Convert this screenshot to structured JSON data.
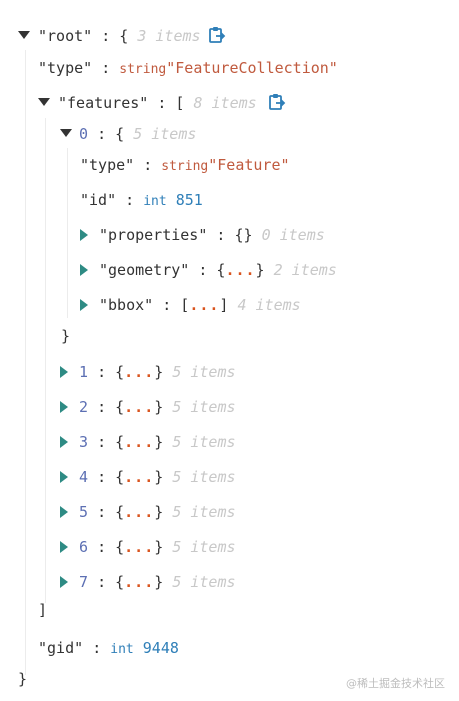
{
  "root": {
    "key": "\"root\"",
    "colon": ":",
    "open": "{",
    "close": "}",
    "count": "3 items"
  },
  "type_row": {
    "key": "\"type\"",
    "colon": ":",
    "type_tag": "string",
    "value": "\"FeatureCollection\""
  },
  "features": {
    "key": "\"features\"",
    "colon": ":",
    "open": "[",
    "close": "]",
    "count": "8 items"
  },
  "feature0": {
    "index": "0",
    "colon": ":",
    "open": "{",
    "close": "}",
    "count": "5 items",
    "type_key": "\"type\"",
    "type_tag": "string",
    "type_value": "\"Feature\"",
    "id_key": "\"id\"",
    "id_tag": "int",
    "id_value": "851",
    "properties_key": "\"properties\"",
    "properties_value": "{}",
    "properties_count": "0 items",
    "geometry_key": "\"geometry\"",
    "geometry_open": "{",
    "geometry_ellipsis": "...",
    "geometry_close": "}",
    "geometry_count": "2 items",
    "bbox_key": "\"bbox\"",
    "bbox_open": "[",
    "bbox_ellipsis": "...",
    "bbox_close": "]",
    "bbox_count": "4 items"
  },
  "collapsed_features": [
    {
      "index": "1",
      "colon": ":",
      "open": "{",
      "ellipsis": "...",
      "close": "}",
      "count": "5 items"
    },
    {
      "index": "2",
      "colon": ":",
      "open": "{",
      "ellipsis": "...",
      "close": "}",
      "count": "5 items"
    },
    {
      "index": "3",
      "colon": ":",
      "open": "{",
      "ellipsis": "...",
      "close": "}",
      "count": "5 items"
    },
    {
      "index": "4",
      "colon": ":",
      "open": "{",
      "ellipsis": "...",
      "close": "}",
      "count": "5 items"
    },
    {
      "index": "5",
      "colon": ":",
      "open": "{",
      "ellipsis": "...",
      "close": "}",
      "count": "5 items"
    },
    {
      "index": "6",
      "colon": ":",
      "open": "{",
      "ellipsis": "...",
      "close": "}",
      "count": "5 items"
    },
    {
      "index": "7",
      "colon": ":",
      "open": "{",
      "ellipsis": "...",
      "close": "}",
      "count": "5 items"
    }
  ],
  "gid_row": {
    "key": "\"gid\"",
    "colon": ":",
    "type_tag": "int",
    "value": "9448"
  },
  "watermark": "@稀土掘金技术社区",
  "colors": {
    "toggle": "#2e8b84",
    "copy_icon": "#2f7fb8",
    "string_value": "#c05a3e",
    "number_value": "#2f7fb8",
    "ellipsis": "#d9541e",
    "count": "#c8c8c8",
    "index": "#5c6fb3"
  },
  "icons": {
    "expanded": "triangle-down-icon",
    "collapsed": "triangle-right-icon",
    "copy": "clipboard-copy-icon"
  }
}
